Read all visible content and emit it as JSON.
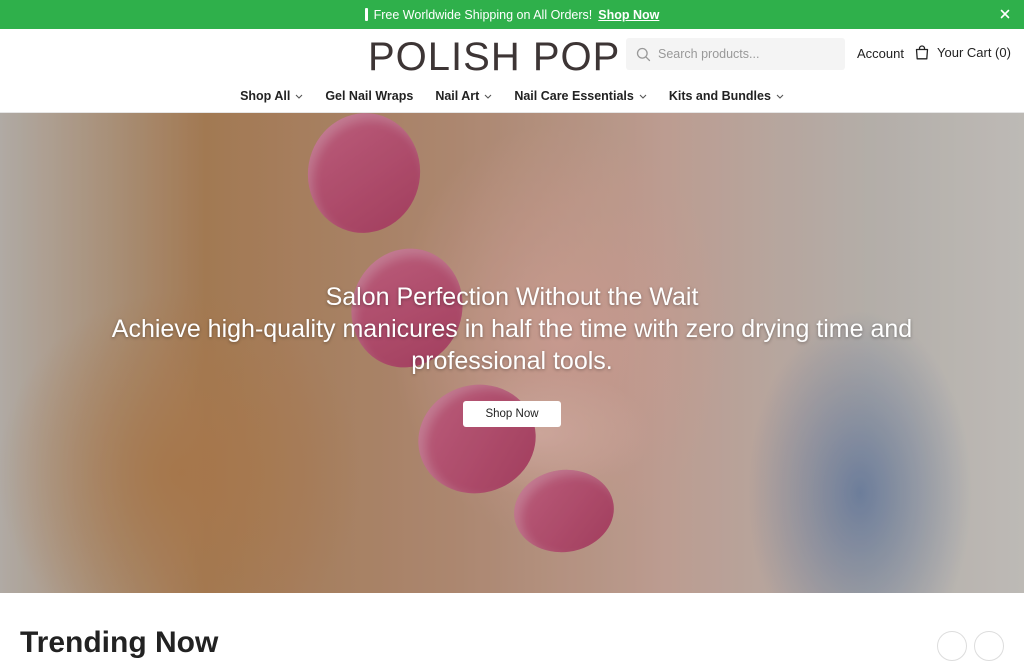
{
  "announcement": {
    "text": "Free Worldwide Shipping on All Orders!",
    "link": "Shop Now"
  },
  "header": {
    "logo": "POLISH POP",
    "search_placeholder": "Search products...",
    "account": "Account",
    "cart": "Your Cart (0)"
  },
  "nav": {
    "items": [
      {
        "label": "Shop All",
        "dropdown": true
      },
      {
        "label": "Gel Nail Wraps",
        "dropdown": false
      },
      {
        "label": "Nail Art",
        "dropdown": true
      },
      {
        "label": "Nail Care Essentials",
        "dropdown": true
      },
      {
        "label": "Kits and Bundles",
        "dropdown": true
      }
    ]
  },
  "hero": {
    "title": "Salon Perfection Without the Wait",
    "subtitle": "Achieve high-quality manicures in half the time with zero drying time and professional tools.",
    "button": "Shop Now"
  },
  "section": {
    "title": "Trending Now"
  },
  "colors": {
    "accent": "#2fb04b",
    "nail": "#c9577a"
  }
}
